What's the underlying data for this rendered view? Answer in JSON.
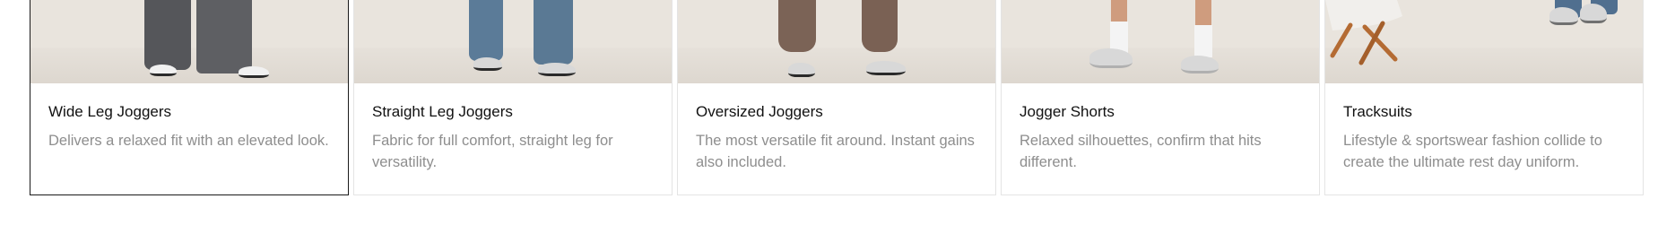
{
  "cards": [
    {
      "title": "Wide Leg Joggers",
      "description": "Delivers a relaxed fit with an elevated look.",
      "image_alt": "wide-leg-joggers-photo",
      "active": true
    },
    {
      "title": "Straight Leg Joggers",
      "description": "Fabric for full comfort, straight leg for versatility.",
      "image_alt": "straight-leg-joggers-photo",
      "active": false
    },
    {
      "title": "Oversized Joggers",
      "description": "The most versatile fit around. Instant gains also included.",
      "image_alt": "oversized-joggers-photo",
      "active": false
    },
    {
      "title": "Jogger Shorts",
      "description": "Relaxed silhouettes, confirm that hits different.",
      "image_alt": "jogger-shorts-photo",
      "active": false
    },
    {
      "title": "Tracksuits",
      "description": "Lifestyle & sportswear fashion collide to create the ultimate rest day uniform.",
      "image_alt": "tracksuits-photo",
      "active": false
    }
  ],
  "colors": {
    "image_background": "#e9e4dd",
    "title_text": "#111111",
    "description_text": "#8e8e8e",
    "active_border": "#1a1a1a",
    "card_border": "#e4e4e4"
  }
}
